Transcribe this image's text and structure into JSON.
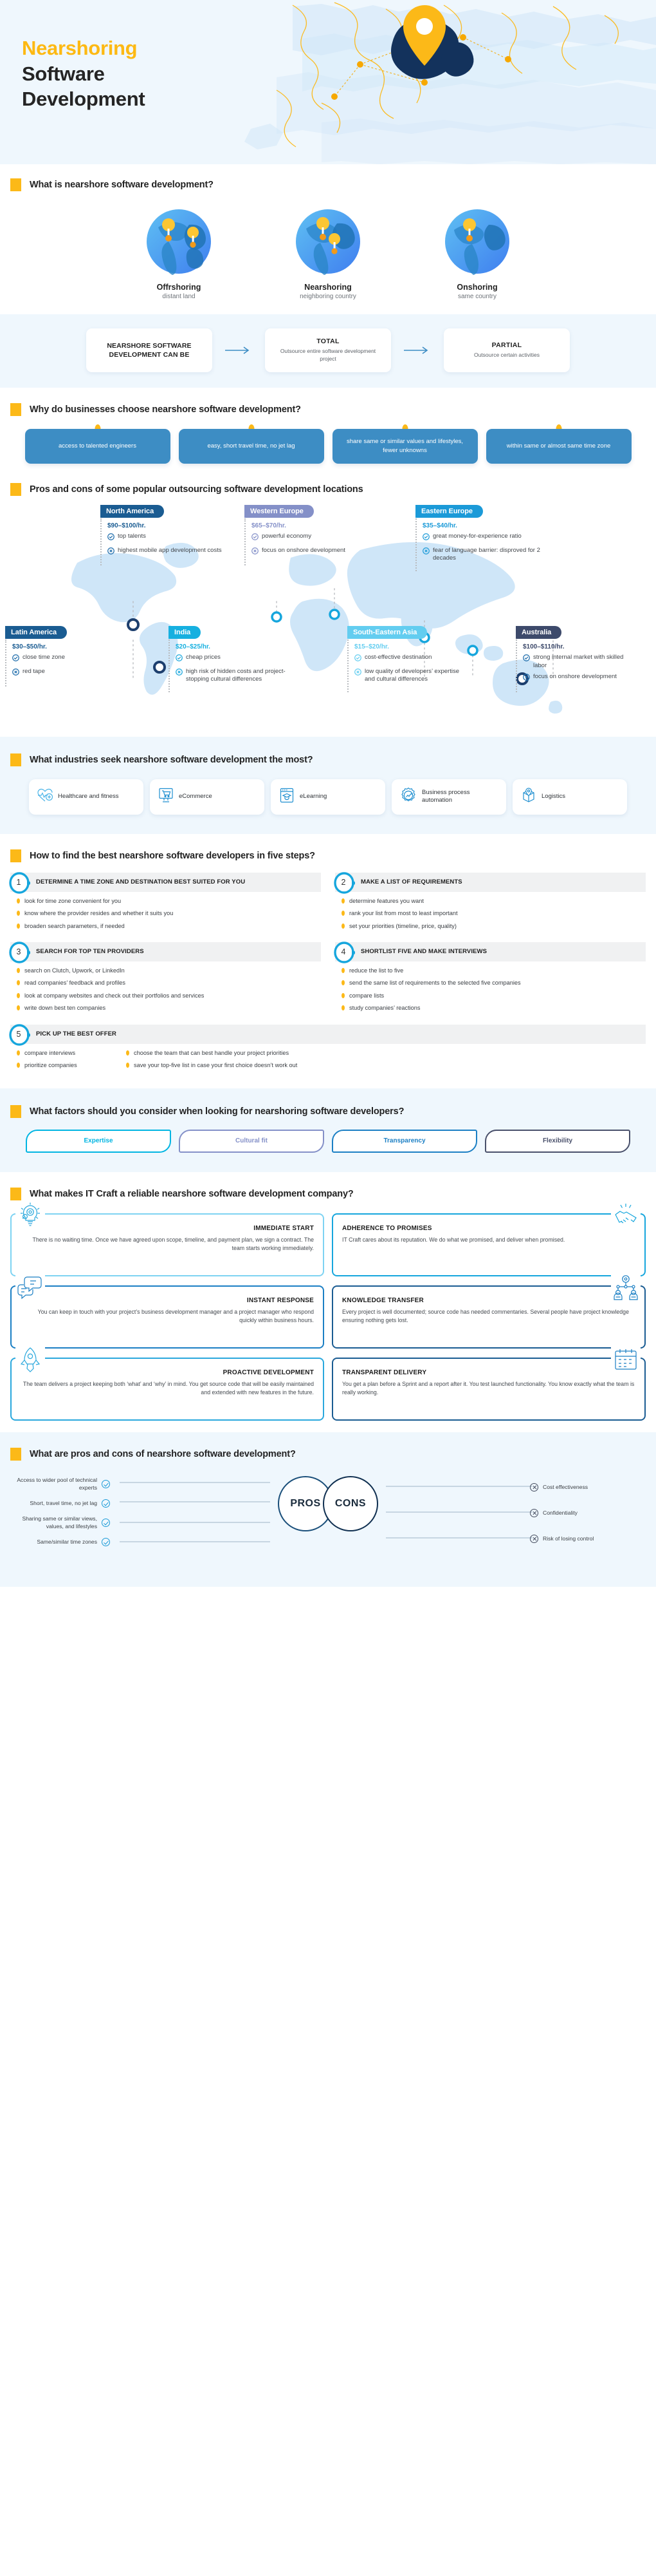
{
  "hero": {
    "line1": "Nearshoring",
    "line2": "Software",
    "line3": "Development"
  },
  "colors": {
    "yellow": "#fcb918",
    "blue": "#3d8dc4",
    "cyan": "#00b5e2",
    "navy": "#1a4f7a",
    "bg_light": "#eff7fd"
  },
  "section_what_is": {
    "heading": "What is nearshore software development?",
    "globes": [
      {
        "name": "Offrshoring",
        "sub": "distant land",
        "icon": "globe-icon"
      },
      {
        "name": "Nearshoring",
        "sub": "neighboring country",
        "icon": "globe-icon"
      },
      {
        "name": "Onshoring",
        "sub": "same country",
        "icon": "globe-icon"
      }
    ]
  },
  "can_be": {
    "lead": "NEARSHORE SOFTWARE DEVELOPMENT CAN BE",
    "options": [
      {
        "title": "TOTAL",
        "desc": "Outsource entire software development project"
      },
      {
        "title": "PARTIAL",
        "desc": "Outsource certain activities"
      }
    ]
  },
  "section_why": {
    "heading": "Why do businesses choose nearshore software development?",
    "boxes": [
      "access to talented engineers",
      "easy, short travel time, no jet lag",
      "share same or similar values and lifestyles, fewer unknowns",
      "within same or almost same time zone"
    ]
  },
  "section_locations": {
    "heading": "Pros and cons of some popular outsourcing software development locations",
    "cards": [
      {
        "name": "North America",
        "price": "$90–$100/hr.",
        "color": "#1a5c92",
        "price_color": "#1a5c92",
        "pros": [
          "top talents"
        ],
        "cons": [
          "highest mobile app development costs"
        ]
      },
      {
        "name": "Western Europe",
        "price": "$65–$70/hr.",
        "color": "#8490c8",
        "price_color": "#8490c8",
        "pros": [
          "powerful economy"
        ],
        "cons": [
          "focus on onshore development"
        ]
      },
      {
        "name": "Eastern Europe",
        "price": "$35–$40/hr.",
        "color": "#1b9ad8",
        "price_color": "#1b9ad8",
        "pros": [
          "great money-for-experience ratio"
        ],
        "cons": [
          "fear of language barrier: disproved for 2 decades"
        ]
      },
      {
        "name": "Latin America",
        "price": "$30–$50/hr.",
        "color": "#1a5c92",
        "price_color": "#1a5c92",
        "pros": [
          "close time zone"
        ],
        "cons": [
          "red tape"
        ]
      },
      {
        "name": "India",
        "price": "$20–$25/hr.",
        "color": "#16b0e0",
        "price_color": "#16b0e0",
        "pros": [
          "cheap prices"
        ],
        "cons": [
          "high risk of hidden costs and project-stopping cultural differences"
        ]
      },
      {
        "name": "South-Eastern Asia",
        "price": "$15–$20/hr.",
        "color": "#63cdf0",
        "price_color": "#63cdf0",
        "pros": [
          "cost-effective destination"
        ],
        "cons": [
          "low quality of developers’ expertise and cultural differences"
        ]
      },
      {
        "name": "Australia",
        "price": "$100–$110/hr.",
        "color": "#3d4a6b",
        "price_color": "#3d4a6b",
        "pros": [
          "strong internal market with skilled labor"
        ],
        "cons": [
          "focus on onshore development"
        ]
      }
    ]
  },
  "section_industries": {
    "heading": "What industries seek nearshore software development the most?",
    "items": [
      {
        "label": "Healthcare and fitness",
        "icon": "heart-pulse-icon"
      },
      {
        "label": "eCommerce",
        "icon": "cart-monitor-icon"
      },
      {
        "label": "eLearning",
        "icon": "graduation-browser-icon"
      },
      {
        "label": "Business process automation",
        "icon": "gear-chart-icon"
      },
      {
        "label": "Logistics",
        "icon": "box-pin-icon"
      }
    ]
  },
  "section_steps": {
    "heading": "How to find the best nearshore software developers in five steps?",
    "steps": [
      {
        "num": "1",
        "title": "DETERMINE A TIME ZONE AND DESTINATION BEST SUITED FOR YOU",
        "items": [
          "look for time zone convenient for you",
          "know where the provider resides and whether it suits you",
          "broaden search parameters, if needed"
        ]
      },
      {
        "num": "2",
        "title": "MAKE A LIST OF REQUIREMENTS",
        "items": [
          "determine features you want",
          "rank your list from most to least important",
          "set your priorities (timeline, price, quality)"
        ]
      },
      {
        "num": "3",
        "title": "SEARCH FOR TOP TEN PROVIDERS",
        "items": [
          "search on Clutch, Upwork, or LinkedIn",
          "read companies’ feedback and profiles",
          "look at company websites and check out their portfolios and services",
          "write down best ten companies"
        ]
      },
      {
        "num": "4",
        "title": "SHORTLIST FIVE AND MAKE INTERVIEWS",
        "items": [
          "reduce the list to five",
          "send the same list of requirements to the selected five companies",
          "compare lists",
          "study companies’ reactions"
        ]
      }
    ],
    "step5": {
      "num": "5",
      "title": "PICK UP THE BEST OFFER",
      "col_left": [
        "compare interviews",
        "prioritize companies"
      ],
      "col_right": [
        "choose the team that can best handle your project priorities",
        "save your top-five list in case your first choice doesn’t work out"
      ]
    }
  },
  "section_factors": {
    "heading": "What factors should you consider when looking for nearshoring software developers?",
    "chips": [
      {
        "label": "Expertise",
        "color": "#00b5e2"
      },
      {
        "label": "Cultural fit",
        "color": "#8490c8"
      },
      {
        "label": "Transparency",
        "color": "#1b7fc4"
      },
      {
        "label": "Flexibility",
        "color": "#49506b"
      }
    ]
  },
  "section_craft": {
    "heading": "What makes IT Craft a reliable nearshore software development company?",
    "cards": [
      {
        "title": "IMMEDIATE START",
        "text": "There is no waiting time. Once we have agreed upon scope, timeline, and payment plan, we sign a contract. The team starts working immediately.",
        "icon": "lightbulb-gear-icon",
        "align": "right",
        "border": "#7ed3f2"
      },
      {
        "title": "ADHERENCE TO PROMISES",
        "text": "IT Craft cares about its reputation. We do what we promised, and deliver when promised.",
        "icon": "handshake-icon",
        "align": "left",
        "border": "#16a6dd"
      },
      {
        "title": "INSTANT RESPONSE",
        "text": "You can keep in touch with your project’s business development manager and a project manager who respond quickly within business hours.",
        "icon": "chat-bubbles-icon",
        "align": "right",
        "border": "#1b7fc4"
      },
      {
        "title": "KNOWLEDGE TRANSFER",
        "text": "Every project is well documented; source code has needed commentaries. Several people have project knowledge ensuring nothing gets lost.",
        "icon": "people-network-icon",
        "align": "left",
        "border": "#1a5c92"
      },
      {
        "title": "PROACTIVE DEVELOPMENT",
        "text": "The team delivers a project keeping both ‘what’ and ‘why’ in mind. You get source code that will be easily maintained and extended with new features in the future.",
        "icon": "rocket-icon",
        "align": "right",
        "border": "#2aa8dd"
      },
      {
        "title": "TRANSPARENT DELIVERY",
        "text": "You get a plan before a Sprint and a report after it. You test launched functionality. You know exactly what the team is really working.",
        "icon": "calendar-icon",
        "align": "left",
        "border": "#1a5c92"
      }
    ]
  },
  "section_final": {
    "heading": "What are pros and cons of nearshore software development?",
    "pros_label": "PROS",
    "cons_label": "CONS",
    "pros": [
      "Access to wider pool of technical experts",
      "Short, travel time, no jet lag",
      "Sharing same or similar views, values, and lifestyles",
      "Same/similar time zones"
    ],
    "cons": [
      "Cost effectiveness",
      "Confidentiality",
      "Risk of losing control"
    ]
  }
}
